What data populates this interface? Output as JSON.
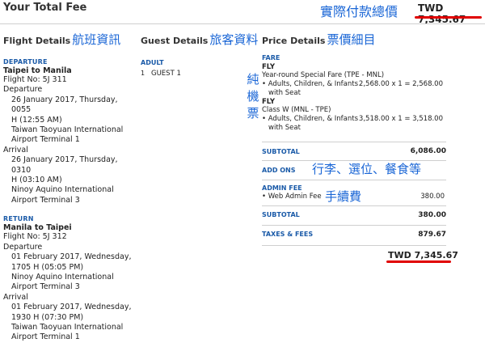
{
  "header": {
    "title": "Your Total Fee",
    "cjk_note": "實際付款總價",
    "total": "TWD 7,345.67"
  },
  "flight": {
    "heading": "Flight Details",
    "heading_cjk": "航班資訊",
    "departure": {
      "label": "DEPARTURE",
      "route": "Taipei to Manila",
      "flight_no": "Flight No: 5J 311",
      "dep_label": "Departure",
      "dep_time_1": "26 January 2017, Thursday, 0055",
      "dep_time_2": "H (12:55 AM)",
      "dep_airport_1": "Taiwan Taoyuan International",
      "dep_airport_2": "Airport Terminal 1",
      "arr_label": "Arrival",
      "arr_time_1": "26 January 2017, Thursday, 0310",
      "arr_time_2": "H (03:10 AM)",
      "arr_airport_1": "Ninoy Aquino International",
      "arr_airport_2": "Airport Terminal 3"
    },
    "return": {
      "label": "RETURN",
      "route": "Manila to Taipei",
      "flight_no": "Flight No: 5J 312",
      "dep_label": "Departure",
      "dep_time_1": "01 February 2017, Wednesday,",
      "dep_time_2": "1705 H (05:05 PM)",
      "dep_airport_1": "Ninoy Aquino International",
      "dep_airport_2": "Airport Terminal 3",
      "arr_label": "Arrival",
      "arr_time_1": "01 February 2017, Wednesday,",
      "arr_time_2": "1930 H (07:30 PM)",
      "arr_airport_1": "Taiwan Taoyuan International",
      "arr_airport_2": "Airport Terminal 1"
    }
  },
  "guest": {
    "heading": "Guest Details",
    "heading_cjk": "旅客資料",
    "type_label": "ADULT",
    "rows": [
      {
        "num": "1",
        "name": "GUEST 1"
      }
    ]
  },
  "annotation_pure_ticket": "純機票",
  "price": {
    "heading": "Price Details",
    "heading_cjk": "票價細目",
    "fare_label": "FARE",
    "fly_1": "FLY",
    "fare_desc_1": "Year-round Special Fare (TPE - MNL)",
    "item_1_label": "• Adults, Children, & Infants",
    "item_1_calc": "2,568.00 x 1 = 2,568.00",
    "item_1_seat": "with Seat",
    "fly_2": "FLY",
    "fare_desc_2": "Class W (MNL - TPE)",
    "item_2_label": "• Adults, Children, & Infants",
    "item_2_calc": "3,518.00 x 1 = 3,518.00",
    "item_2_seat": "with Seat",
    "subtotal_1_label": "SUBTOTAL",
    "subtotal_1_value": "6,086.00",
    "addons_label": "ADD ONS",
    "addons_cjk": "行李、選位、餐食等",
    "admin_fee_label": "ADMIN FEE",
    "admin_item_label": "• Web Admin Fee",
    "admin_item_value": "380.00",
    "admin_cjk": "手續費",
    "subtotal_2_label": "SUBTOTAL",
    "subtotal_2_value": "380.00",
    "taxes_label": "TAXES & FEES",
    "taxes_value": "879.67",
    "grand_total": "TWD 7,345.67"
  },
  "colors": {
    "annotation_blue": "#1a66d6",
    "label_blue": "#1a5aa8",
    "underline_red": "#e00000"
  }
}
